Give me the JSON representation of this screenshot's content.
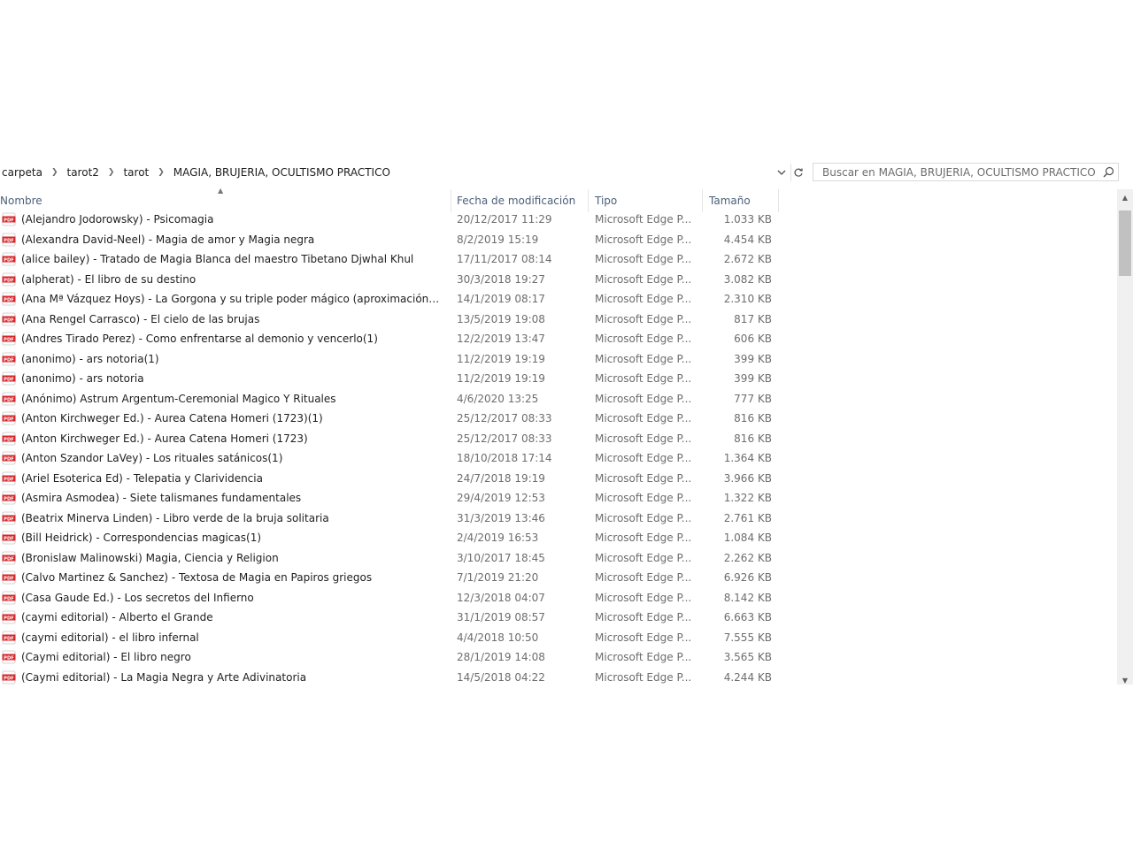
{
  "address": {
    "crumbs": [
      "carpeta",
      "tarot2",
      "tarot",
      "MAGIA, BRUJERIA, OCULTISMO PRACTICO"
    ]
  },
  "search": {
    "placeholder": "Buscar en MAGIA, BRUJERIA, OCULTISMO PRACTICO"
  },
  "columns": {
    "name": "Nombre",
    "date": "Fecha de modificación",
    "type": "Tipo",
    "size": "Tamaño"
  },
  "icons": {
    "file": "pdf-file-icon",
    "search": "search-icon",
    "refresh": "refresh-icon",
    "dropdown": "chevron-down-icon"
  },
  "colors": {
    "pdf_icon": "#d6262b",
    "header_text": "#4c607a"
  },
  "files": [
    {
      "name": "(Alejandro Jodorowsky) - Psicomagia",
      "date": "20/12/2017 11:29",
      "type": "Microsoft Edge P...",
      "size": "1.033 KB"
    },
    {
      "name": "(Alexandra David-Neel) - Magia de amor y Magia negra",
      "date": "8/2/2019 15:19",
      "type": "Microsoft Edge P...",
      "size": "4.454 KB"
    },
    {
      "name": "(alice bailey) - Tratado de Magia Blanca del maestro Tibetano Djwhal Khul",
      "date": "17/11/2017 08:14",
      "type": "Microsoft Edge P...",
      "size": "2.672 KB"
    },
    {
      "name": "(alpherat) - El libro de su destino",
      "date": "30/3/2018 19:27",
      "type": "Microsoft Edge P...",
      "size": "3.082 KB"
    },
    {
      "name": "(Ana Mª Vázquez Hoys) - La Gorgona y su triple poder mágico (aproximación a la ...",
      "date": "14/1/2019 08:17",
      "type": "Microsoft Edge P...",
      "size": "2.310 KB"
    },
    {
      "name": "(Ana Rengel Carrasco) - El cielo de las brujas",
      "date": "13/5/2019 19:08",
      "type": "Microsoft Edge P...",
      "size": "817 KB"
    },
    {
      "name": "(Andres Tirado Perez) - Como enfrentarse al demonio y vencerlo(1)",
      "date": "12/2/2019 13:47",
      "type": "Microsoft Edge P...",
      "size": "606 KB"
    },
    {
      "name": "(anonimo) - ars notoria(1)",
      "date": "11/2/2019 19:19",
      "type": "Microsoft Edge P...",
      "size": "399 KB"
    },
    {
      "name": "(anonimo) - ars notoria",
      "date": "11/2/2019 19:19",
      "type": "Microsoft Edge P...",
      "size": "399 KB"
    },
    {
      "name": "(Anónimo) Astrum Argentum-Ceremonial Magico Y Rituales",
      "date": "4/6/2020 13:25",
      "type": "Microsoft Edge P...",
      "size": "777 KB"
    },
    {
      "name": "(Anton Kirchweger Ed.) - Aurea Catena Homeri (1723)(1)",
      "date": "25/12/2017 08:33",
      "type": "Microsoft Edge P...",
      "size": "816 KB"
    },
    {
      "name": "(Anton Kirchweger Ed.) - Aurea Catena Homeri (1723)",
      "date": "25/12/2017 08:33",
      "type": "Microsoft Edge P...",
      "size": "816 KB"
    },
    {
      "name": "(Anton Szandor LaVey) - Los rituales satánicos(1)",
      "date": "18/10/2018 17:14",
      "type": "Microsoft Edge P...",
      "size": "1.364 KB"
    },
    {
      "name": "(Ariel Esoterica Ed) - Telepatia y Clarividencia",
      "date": "24/7/2018 19:19",
      "type": "Microsoft Edge P...",
      "size": "3.966 KB"
    },
    {
      "name": "(Asmira Asmodea) - Siete talismanes fundamentales",
      "date": "29/4/2019 12:53",
      "type": "Microsoft Edge P...",
      "size": "1.322 KB"
    },
    {
      "name": "(Beatrix Minerva Linden) - Libro verde de la bruja solitaria",
      "date": "31/3/2019 13:46",
      "type": "Microsoft Edge P...",
      "size": "2.761 KB"
    },
    {
      "name": "(Bill Heidrick) - Correspondencias magicas(1)",
      "date": "2/4/2019 16:53",
      "type": "Microsoft Edge P...",
      "size": "1.084 KB"
    },
    {
      "name": "(Bronislaw Malinowski)  Magia, Ciencia y Religion",
      "date": "3/10/2017 18:45",
      "type": "Microsoft Edge P...",
      "size": "2.262 KB"
    },
    {
      "name": "(Calvo Martinez & Sanchez) - Textosa de Magia en Papiros griegos",
      "date": "7/1/2019 21:20",
      "type": "Microsoft Edge P...",
      "size": "6.926 KB"
    },
    {
      "name": "(Casa Gaude Ed.) - Los secretos del Infierno",
      "date": "12/3/2018 04:07",
      "type": "Microsoft Edge P...",
      "size": "8.142 KB"
    },
    {
      "name": "(caymi editorial) - Alberto el Grande",
      "date": "31/1/2019 08:57",
      "type": "Microsoft Edge P...",
      "size": "6.663 KB"
    },
    {
      "name": "(caymi editorial) - el libro infernal",
      "date": "4/4/2018 10:50",
      "type": "Microsoft Edge P...",
      "size": "7.555 KB"
    },
    {
      "name": "(Caymi editorial) - El libro negro",
      "date": "28/1/2019 14:08",
      "type": "Microsoft Edge P...",
      "size": "3.565 KB"
    },
    {
      "name": "(Caymi editorial) - La Magia Negra y Arte Adivinatoria",
      "date": "14/5/2018 04:22",
      "type": "Microsoft Edge P...",
      "size": "4.244 KB"
    }
  ]
}
